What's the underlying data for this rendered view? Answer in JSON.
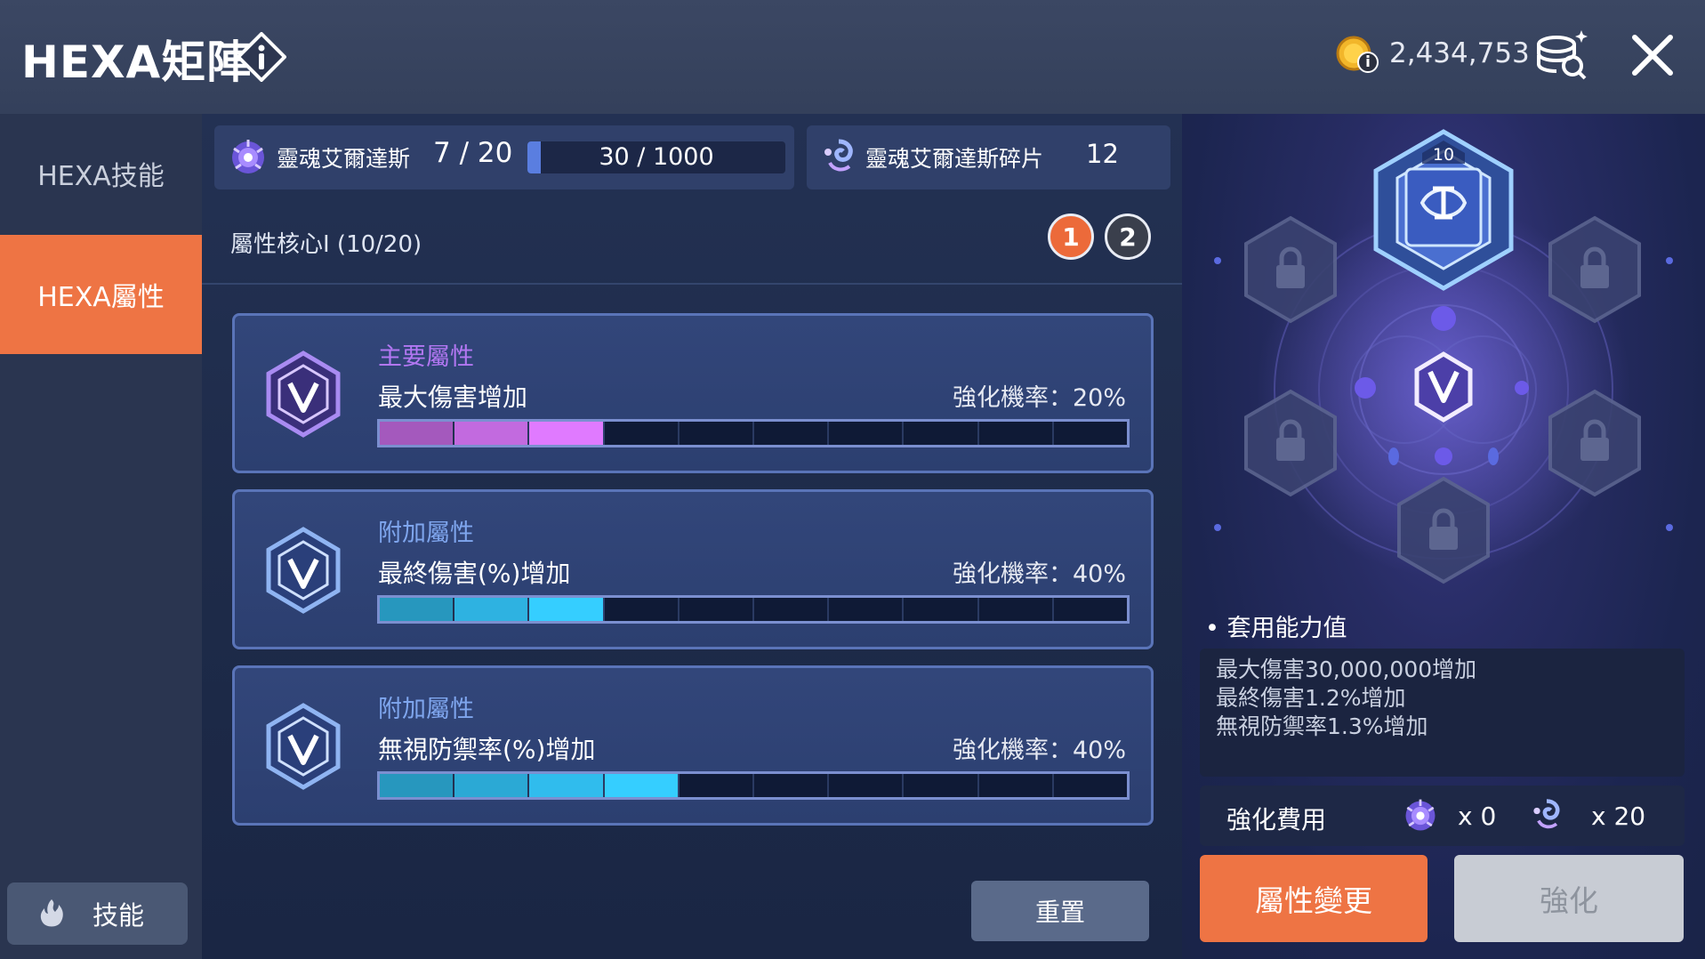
{
  "header": {
    "title": "HEXA矩陣",
    "coins": "2,434,753"
  },
  "sidebar": {
    "tabs": [
      {
        "label": "HEXA技能",
        "active": false
      },
      {
        "label": "HEXA屬性",
        "active": true
      }
    ],
    "skill_button": "技能"
  },
  "resources": {
    "soul_erdas": {
      "label": "靈魂艾爾達斯",
      "count": "7 / 20"
    },
    "exp": {
      "text": "30 / 1000",
      "fraction": 0.03
    },
    "fragments": {
      "label": "靈魂艾爾達斯碎片",
      "count": "12"
    }
  },
  "core": {
    "title": "屬性核心I (10/20)",
    "pages": [
      "1",
      "2"
    ],
    "active_page": "1"
  },
  "attributes": [
    {
      "type": "主要屬性",
      "name": "最大傷害增加",
      "rate": "強化機率：20%",
      "filled": 3,
      "total": 10,
      "type_color": "#b277f2",
      "fill_color": "#c86de6"
    },
    {
      "type": "附加屬性",
      "name": "最終傷害(%)增加",
      "rate": "強化機率：40%",
      "filled": 3,
      "total": 10,
      "type_color": "#7fa6ee",
      "fill_color": "#2fb8e8"
    },
    {
      "type": "附加屬性",
      "name": "無視防禦率(%)增加",
      "rate": "強化機率：40%",
      "filled": 4,
      "total": 10,
      "type_color": "#7fa6ee",
      "fill_color": "#2fb8e8"
    }
  ],
  "reset_button": "重置",
  "hex_core": {
    "level": "10"
  },
  "applied": {
    "title": "套用能力值",
    "lines": [
      "最大傷害30,000,000增加",
      "最終傷害1.2%增加",
      "無視防禦率1.3%增加"
    ]
  },
  "cost": {
    "label": "強化費用",
    "erdas": "x 0",
    "fragments": "x 20"
  },
  "buttons": {
    "change": "屬性變更",
    "enhance": "強化"
  },
  "colors": {
    "accent": "#ee7444",
    "panel": "#2c3f70"
  }
}
